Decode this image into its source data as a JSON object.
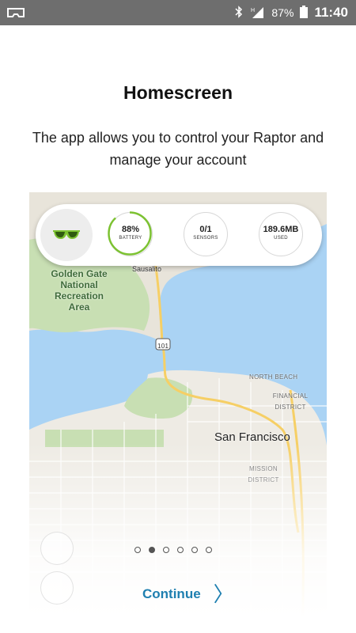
{
  "status_bar": {
    "battery": "87%",
    "time": "11:40",
    "icons": [
      "vr-headset-icon",
      "bluetooth-icon",
      "signal-icon",
      "battery-icon"
    ]
  },
  "page": {
    "title": "Homescreen",
    "subtitle": "The app allows you to control your Raptor and manage your account"
  },
  "preview": {
    "stats": [
      {
        "value": "88%",
        "label": "BATTERY",
        "fraction": 0.88
      },
      {
        "value": "0/1",
        "label": "SENSORS"
      },
      {
        "value": "189.6MB",
        "label": "USED"
      }
    ],
    "map_labels": {
      "park": "Golden Gate\nNational\nRecreation\nArea",
      "sausalito": "Sausalito",
      "city": "San Francisco",
      "north_beach": "NORTH BEACH",
      "financial": "FINANCIAL\nDISTRICT",
      "mission": "MISSION\nDISTRICT",
      "route_101": "101"
    },
    "accent": "#7cc231"
  },
  "pager": {
    "count": 6,
    "active_index": 1
  },
  "continue_label": "Continue"
}
